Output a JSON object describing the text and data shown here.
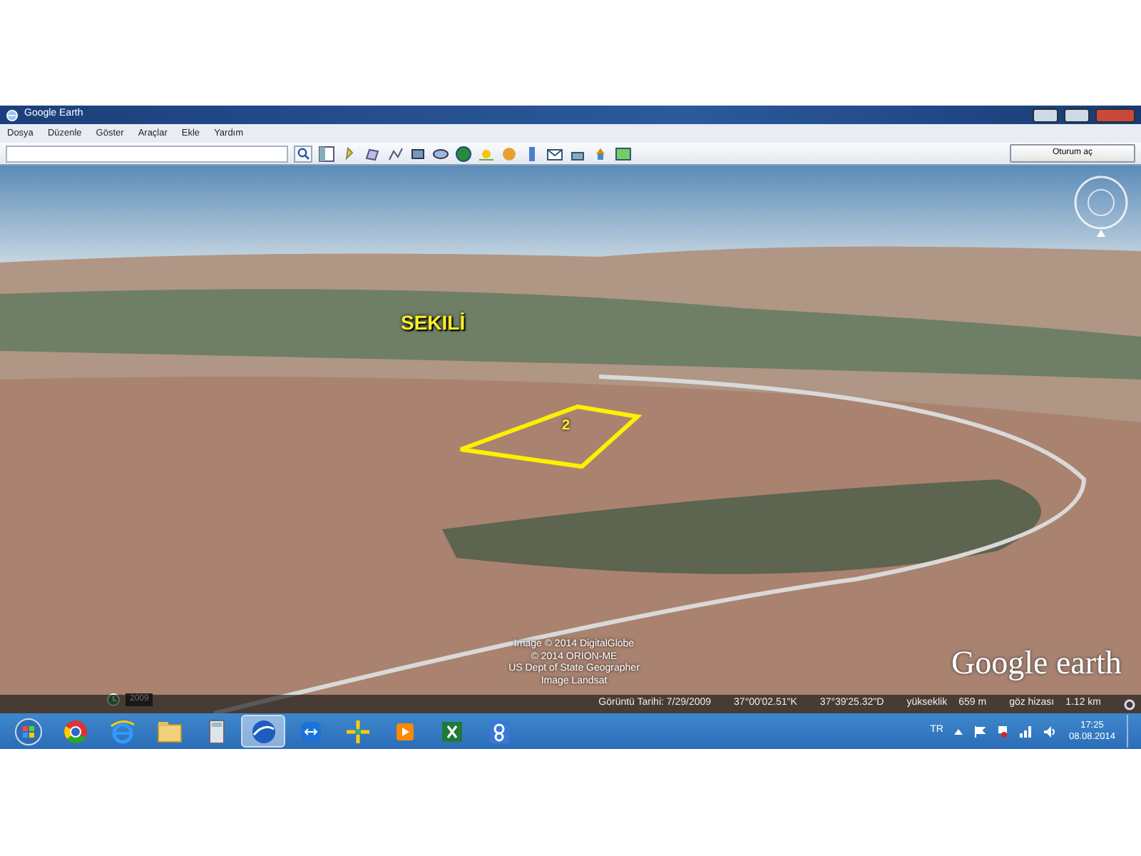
{
  "window": {
    "title": "Google Earth"
  },
  "menu": [
    "Dosya",
    "Düzenle",
    "Göster",
    "Araçlar",
    "Ekle",
    "Yardım"
  ],
  "sign_in_button": "Oturum aç",
  "map": {
    "placemark": "SEKILİ",
    "polygon_label": "2",
    "time_slider": "2009",
    "logo": "Google earth",
    "attribution": [
      "Image © 2014 DigitalGlobe",
      "© 2014 ORION-ME",
      "US Dept of State Geographer",
      "Image Landsat"
    ]
  },
  "status_bar": [
    "Görüntü Tarihi: 7/29/2009",
    "37°00'02.51\"K",
    "37°39'25.32\"D",
    "yükseklik",
    "659 m",
    "göz hizası",
    "1.12 km"
  ],
  "taskbar": {
    "apps": [
      {
        "kind": "start",
        "selected": false
      },
      {
        "kind": "chrome",
        "selected": false
      },
      {
        "kind": "ie",
        "selected": false
      },
      {
        "kind": "folder",
        "selected": false
      },
      {
        "kind": "calculator",
        "selected": false
      },
      {
        "kind": "earth",
        "selected": true
      },
      {
        "kind": "remote",
        "selected": false
      },
      {
        "kind": "arrows",
        "selected": false
      },
      {
        "kind": "player",
        "selected": false
      },
      {
        "kind": "excel",
        "selected": false
      },
      {
        "kind": "g",
        "selected": false
      }
    ],
    "language": "TR",
    "time": "17:25",
    "date": "08.08.2014"
  }
}
